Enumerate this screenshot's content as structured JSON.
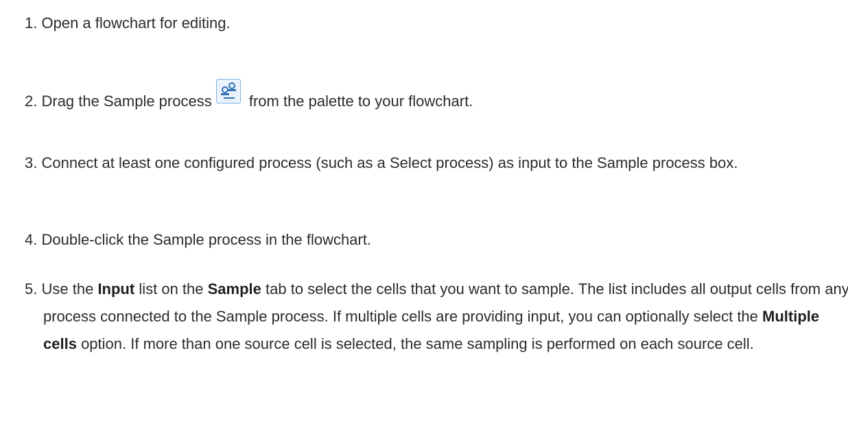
{
  "steps": [
    {
      "num": "1.",
      "text": "Open a flowchart for editing."
    },
    {
      "num": "2.",
      "before": "Drag the Sample process",
      "after": "from the palette to your flowchart.",
      "icon": "sample-process-icon"
    },
    {
      "num": "3.",
      "text": "Connect at least one configured process (such as a Select process) as input to the Sample process box."
    },
    {
      "num": "4.",
      "text": "Double-click the Sample process in the flowchart."
    },
    {
      "num": "5.",
      "p1": "Use the",
      "b1": "Input",
      "p2": "list on the",
      "b2": "Sample",
      "p3": "tab to select the cells that you want to sample. The list includes all output cells from any process connected to the Sample process. If multiple cells are providing input, you can optionally select the",
      "b3": "Multiple cells",
      "p4": "option. If more than one source cell is selected, the same sampling is performed on each source cell."
    }
  ],
  "colors": {
    "text": "#2b2b2b",
    "icon_border": "#7fb3e3",
    "icon_fill": "#eaf3fc",
    "icon_accent": "#2f6fb5"
  }
}
